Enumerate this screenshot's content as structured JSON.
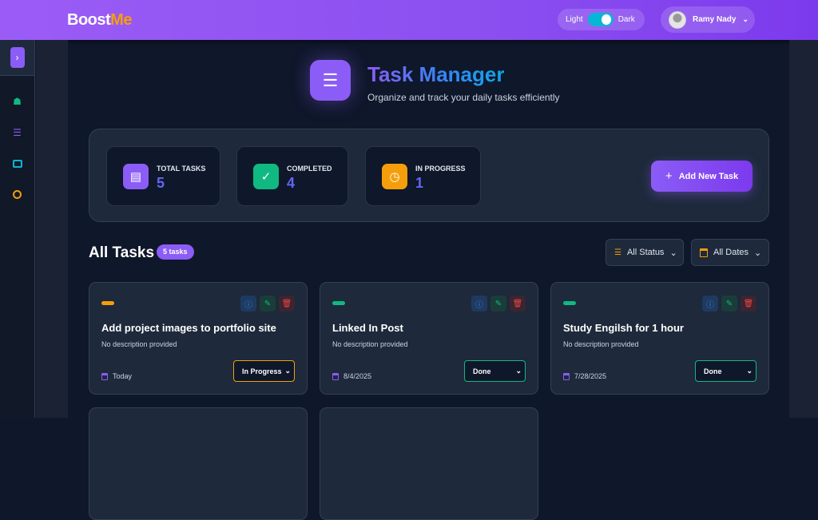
{
  "header": {
    "logo_main": "Boost",
    "logo_accent": "Me",
    "theme_light": "Light",
    "theme_dark": "Dark",
    "user_name": "Ramy Nady"
  },
  "sidebar": {
    "items": [
      {
        "icon": "home-icon",
        "color": "#10b981"
      },
      {
        "icon": "list-icon",
        "color": "#8b5cf6"
      },
      {
        "icon": "calendar-icon",
        "color": "#06b6d4"
      },
      {
        "icon": "timer-icon",
        "color": "#f59e0b"
      }
    ]
  },
  "hero": {
    "title": "Task Manager",
    "subtitle": "Organize and track your daily tasks efficiently"
  },
  "stats": [
    {
      "label": "TOTAL TASKS",
      "value": "5",
      "color": "#8b5cf6"
    },
    {
      "label": "COMPLETED",
      "value": "4",
      "color": "#10b981"
    },
    {
      "label": "IN PROGRESS",
      "value": "1",
      "color": "#f59e0b"
    }
  ],
  "add_button": "Add New Task",
  "tasks_section": {
    "title": "All Tasks",
    "count": "5 tasks",
    "status_filter": "All Status",
    "date_filter": "All Dates"
  },
  "tasks": [
    {
      "title": "Add project images to portfolio site",
      "description": "No description provided",
      "date": "Today",
      "status": "In Progress",
      "color": "#f59e0b"
    },
    {
      "title": "Linked In Post",
      "description": "No description provided",
      "date": "8/4/2025",
      "status": "Done",
      "color": "#10b981"
    },
    {
      "title": "Study Engilsh for 1 hour",
      "description": "No description provided",
      "date": "7/28/2025",
      "status": "Done",
      "color": "#10b981"
    }
  ]
}
